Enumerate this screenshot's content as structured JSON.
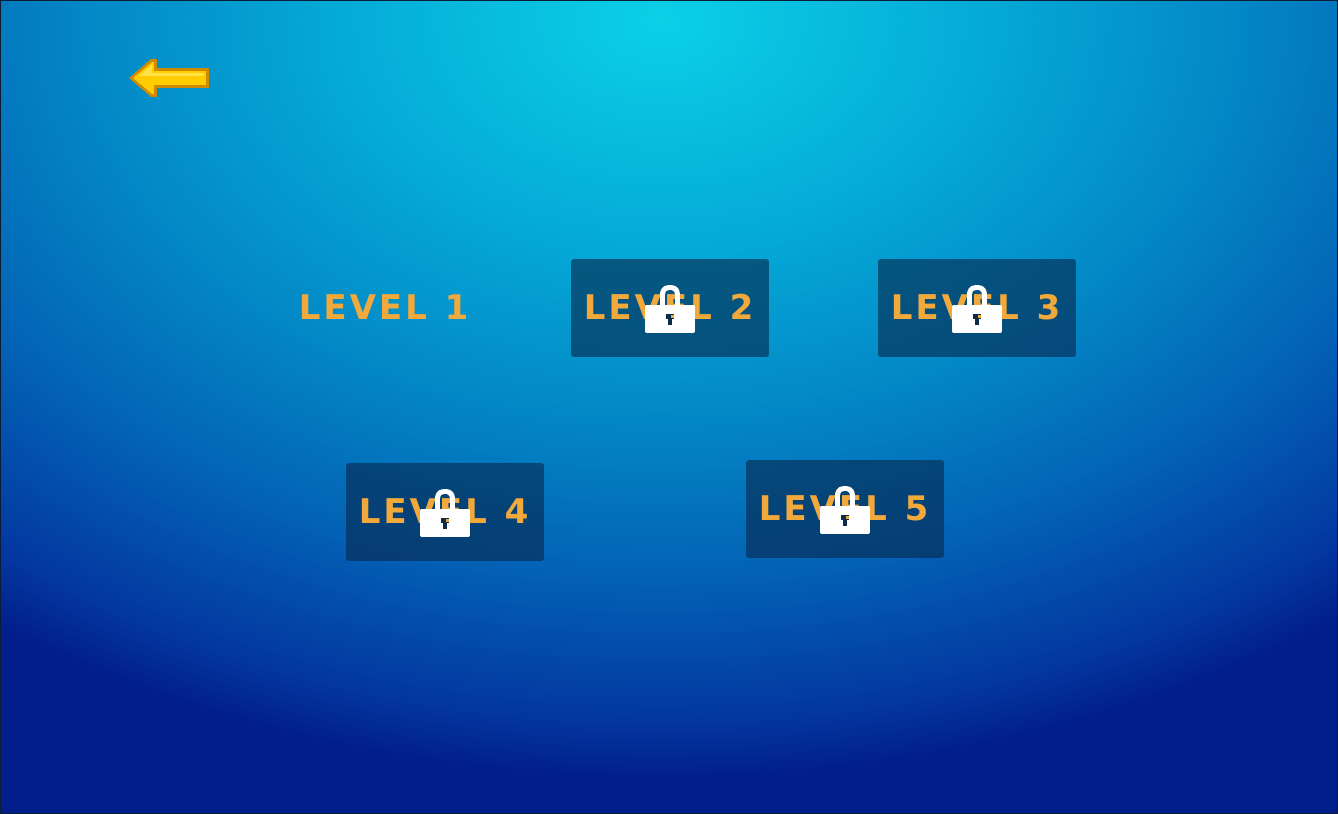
{
  "screen": "level-select",
  "back_button": {
    "icon": "arrow-left-icon",
    "color": "#ffcc00"
  },
  "levels": [
    {
      "label": "LEVEL 1",
      "locked": false
    },
    {
      "label": "LEVEL 2",
      "locked": true,
      "icon": "lock-icon"
    },
    {
      "label": "LEVEL 3",
      "locked": true,
      "icon": "lock-icon"
    },
    {
      "label": "LEVEL 4",
      "locked": true,
      "icon": "lock-icon"
    },
    {
      "label": "LEVEL 5",
      "locked": true,
      "icon": "lock-icon"
    }
  ],
  "colors": {
    "label_text": "#f2a93c",
    "locked_button_bg": "#0a2d55",
    "background_center": "#0bd0e6",
    "background_edge": "#021e8a"
  }
}
